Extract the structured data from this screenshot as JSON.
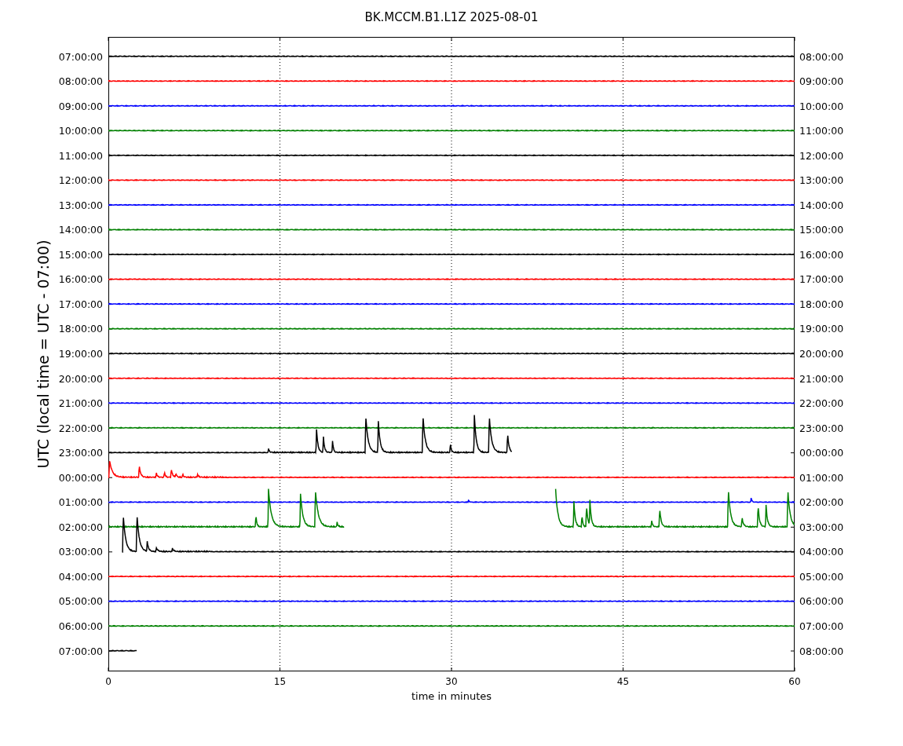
{
  "plot": {
    "title": "BK.MCCM.B1.L1Z 2025-08-01",
    "ylabel": "UTC (local time = UTC - 07:00)",
    "xlabel": "time in minutes",
    "xticks": [
      "0",
      "15",
      "30",
      "45",
      "60"
    ],
    "rows": [
      {
        "utc": "07:00:00",
        "local": "08:00:00",
        "color": "#000000"
      },
      {
        "utc": "08:00:00",
        "local": "09:00:00",
        "color": "#ff0000"
      },
      {
        "utc": "09:00:00",
        "local": "10:00:00",
        "color": "#0000ff"
      },
      {
        "utc": "10:00:00",
        "local": "11:00:00",
        "color": "#008000"
      },
      {
        "utc": "11:00:00",
        "local": "12:00:00",
        "color": "#000000"
      },
      {
        "utc": "12:00:00",
        "local": "13:00:00",
        "color": "#ff0000"
      },
      {
        "utc": "13:00:00",
        "local": "14:00:00",
        "color": "#0000ff"
      },
      {
        "utc": "14:00:00",
        "local": "15:00:00",
        "color": "#008000"
      },
      {
        "utc": "15:00:00",
        "local": "16:00:00",
        "color": "#000000"
      },
      {
        "utc": "16:00:00",
        "local": "17:00:00",
        "color": "#ff0000"
      },
      {
        "utc": "17:00:00",
        "local": "18:00:00",
        "color": "#0000ff"
      },
      {
        "utc": "18:00:00",
        "local": "19:00:00",
        "color": "#008000"
      },
      {
        "utc": "19:00:00",
        "local": "20:00:00",
        "color": "#000000"
      },
      {
        "utc": "20:00:00",
        "local": "21:00:00",
        "color": "#ff0000"
      },
      {
        "utc": "21:00:00",
        "local": "22:00:00",
        "color": "#0000ff"
      },
      {
        "utc": "22:00:00",
        "local": "23:00:00",
        "color": "#008000"
      },
      {
        "utc": "23:00:00",
        "local": "00:00:00",
        "color": "#000000"
      },
      {
        "utc": "00:00:00",
        "local": "01:00:00",
        "color": "#ff0000"
      },
      {
        "utc": "01:00:00",
        "local": "02:00:00",
        "color": "#0000ff"
      },
      {
        "utc": "02:00:00",
        "local": "03:00:00",
        "color": "#008000"
      },
      {
        "utc": "03:00:00",
        "local": "04:00:00",
        "color": "#000000"
      },
      {
        "utc": "04:00:00",
        "local": "05:00:00",
        "color": "#ff0000"
      },
      {
        "utc": "05:00:00",
        "local": "06:00:00",
        "color": "#0000ff"
      },
      {
        "utc": "06:00:00",
        "local": "07:00:00",
        "color": "#008000"
      },
      {
        "utc": "07:00:00",
        "local": "08:00:00",
        "color": "#000000"
      }
    ]
  }
}
